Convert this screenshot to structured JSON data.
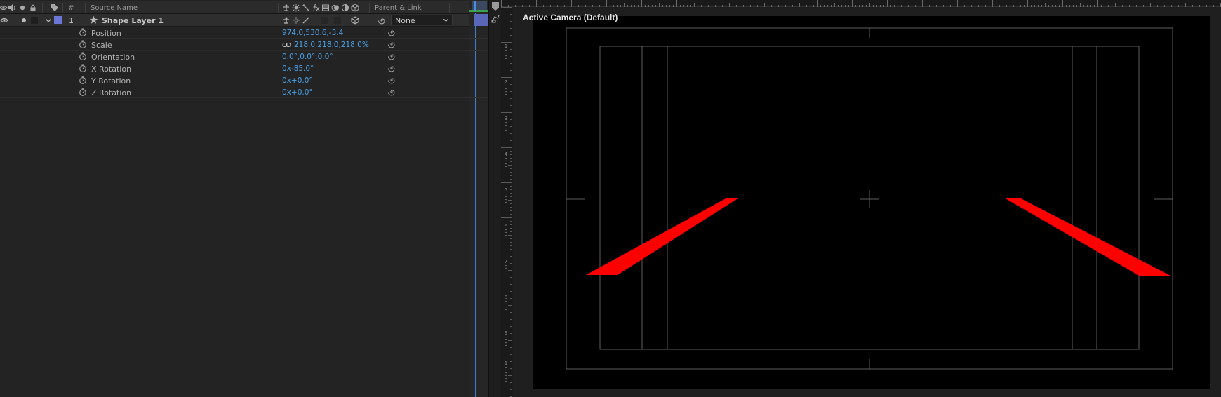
{
  "timeline": {
    "columns": {
      "number": "#",
      "source_name": "Source Name",
      "parent_link": "Parent & Link"
    },
    "layer": {
      "index": "1",
      "name": "Shape Layer 1",
      "parent": "None",
      "label_color": "#6b76d6"
    },
    "properties": [
      {
        "name": "Position",
        "value": "974.0,530.6,-3.4"
      },
      {
        "name": "Scale",
        "value": "218.0,218.0,218.0%"
      },
      {
        "name": "Orientation",
        "value": "0.0°,0.0°,0.0°"
      },
      {
        "name": "X Rotation",
        "value": "0x-85.0°"
      },
      {
        "name": "Y Rotation",
        "value": "0x+0.0°"
      },
      {
        "name": "Z Rotation",
        "value": "0x+0.0°"
      }
    ]
  },
  "viewer": {
    "view_name": "Active Camera (Default)",
    "shape_color": "#ff0000",
    "ruler_labels": [
      "100",
      "200",
      "300",
      "400",
      "500",
      "600",
      "700",
      "800",
      "900",
      "1000"
    ]
  }
}
